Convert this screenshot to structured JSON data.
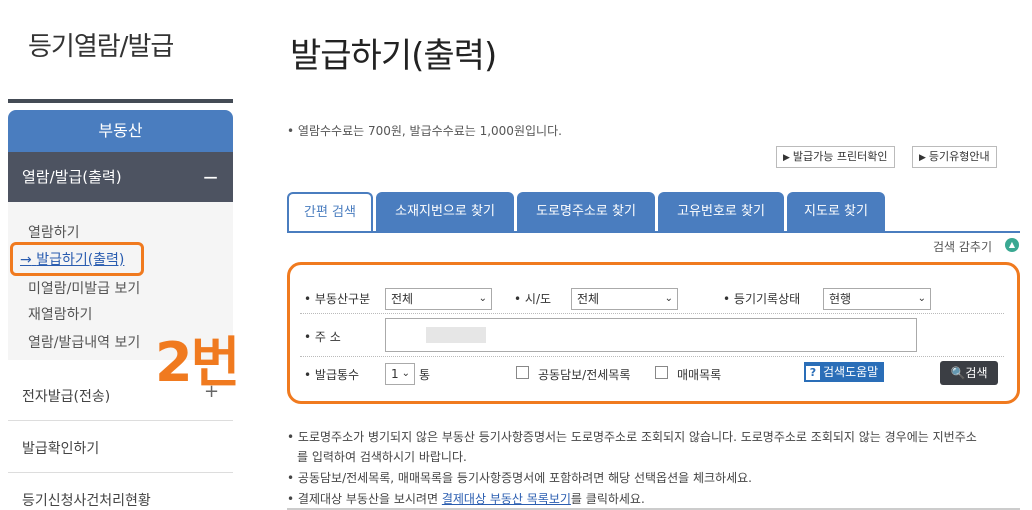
{
  "sidebar": {
    "title": "등기열람/발급",
    "category": "부동산",
    "active_section": "열람/발급(출력)",
    "active_section_toggle": "−",
    "sub_items": [
      "열람하기",
      "발급하기(출력)",
      "미열람/미발급 보기",
      "재열람하기",
      "열람/발급내역 보기"
    ],
    "current_marker": "→",
    "menu_items": [
      "전자발급(전송)",
      "발급확인하기",
      "등기신청사건처리현황"
    ],
    "menu_toggle": "+",
    "annotation": "2번"
  },
  "main": {
    "title": "발급하기(출력)",
    "fee_note": "열람수수료는 700원, 발급수수료는 1,000원입니다.",
    "buttons": [
      "발급가능 프린터확인",
      "등기유형안내"
    ],
    "tabs": [
      "간편 검색",
      "소재지번으로 찾기",
      "도로명주소로 찾기",
      "고유번호로 찾기",
      "지도로 찾기"
    ],
    "hide_search": "검색 감추기",
    "form": {
      "property_type_label": "부동산구분",
      "property_type_value": "전체",
      "region_label": "시/도",
      "region_value": "전체",
      "record_status_label": "등기기록상태",
      "record_status_value": "현행",
      "address_label": "주 소",
      "count_label": "발급통수",
      "count_value": "1",
      "count_unit": "통",
      "joint_collateral": "공동담보/전세목록",
      "sale_list": "매매목록",
      "help_button": "검색도움말",
      "search_button": "검색"
    },
    "notes": {
      "line1": "도로명주소가 병기되지 않은 부동산 등기사항증명서는 도로명주소로 조회되지 않습니다. 도로명주소로 조회되지 않는 경우에는 지번주소",
      "line1b": "를 입력하여 검색하시기 바랍니다.",
      "line2": "공동담보/전세목록, 매매목록을 등기사항증명서에 포함하려면 해당 선택옵션을 체크하세요.",
      "line3_pre": "결제대상 부동산을 보시려면 ",
      "line3_link": "결제대상 부동산 목록보기",
      "line3_post": "를 클릭하세요."
    }
  }
}
